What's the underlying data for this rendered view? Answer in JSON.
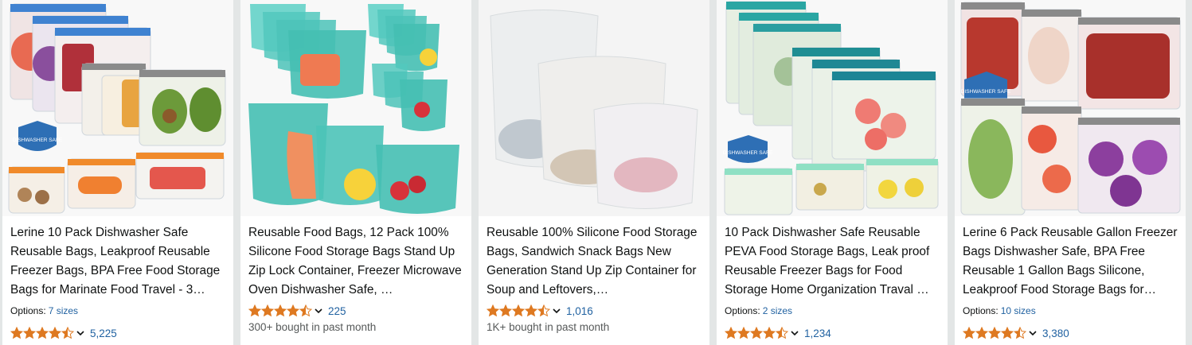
{
  "colors": {
    "star": "#de7921",
    "link": "#2162a1",
    "text": "#0f1111",
    "muted": "#565959"
  },
  "products": [
    {
      "title": "Lerine 10 Pack Dishwasher Safe Reusable Bags, Leakproof Reusable Freezer Bags, BPA Free Food Storage Bags for Marinate Food Travel - 3…",
      "options_label": "Options:",
      "options_value": "7 sizes",
      "rating": 4.5,
      "review_count": "5,225",
      "image_badge": "DISHWASHER SAFE"
    },
    {
      "title": "Reusable Food Bags, 12 Pack 100% Silicone Food Storage Bags Stand Up Zip Lock Container, Freezer Microwave Oven Dishwasher Safe, …",
      "rating": 4.5,
      "review_count": "225",
      "bought": "300+ bought in past month"
    },
    {
      "title": "Reusable 100% Silicone Food Storage Bags, Sandwich Snack Bags New Generation Stand Up Zip Container for Soup and Leftovers,…",
      "rating": 4.5,
      "review_count": "1,016",
      "bought": "1K+ bought in past month"
    },
    {
      "title": "10 Pack Dishwasher Safe Reusable PEVA Food Storage Bags, Leak proof Reusable Freezer Bags for Food Storage Home Organization Traval …",
      "options_label": "Options:",
      "options_value": "2 sizes",
      "rating": 4.5,
      "review_count": "1,234",
      "image_badge": "DISHWASHER SAFE"
    },
    {
      "title": "Lerine 6 Pack Reusable Gallon Freezer Bags Dishwasher Safe, BPA Free Reusable 1 Gallon Bags Silicone, Leakproof Food Storage Bags for…",
      "options_label": "Options:",
      "options_value": "10 sizes",
      "rating": 4.5,
      "review_count": "3,380",
      "image_badge": "DISHWASHER SAFE"
    }
  ]
}
